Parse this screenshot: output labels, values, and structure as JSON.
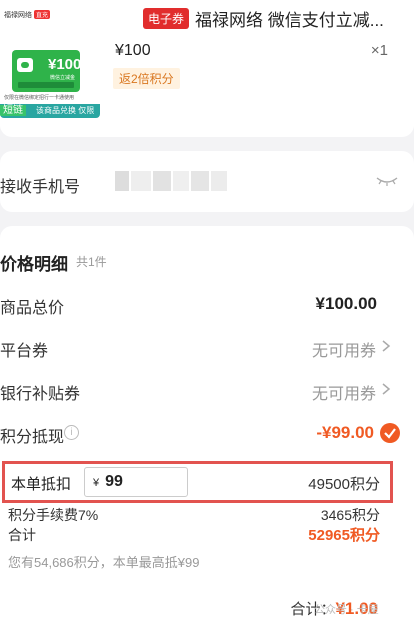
{
  "product": {
    "tag": "电子券",
    "title": "福禄网络 微信支付立减...",
    "price": "¥100",
    "qty": "×1",
    "points_badge": "返2倍积分",
    "thumb": {
      "brand": "福禄网络",
      "brand_badge": "直充",
      "amount": "¥100",
      "sub": "微信立减金",
      "note": "仅限在微信绑定招行一卡通使用",
      "bottom_tag": "短链",
      "bottom_text": "该商品兑换 仅限"
    }
  },
  "phone": {
    "label": "接收手机号"
  },
  "details": {
    "title": "价格明细",
    "count": "共1件",
    "rows": [
      {
        "label": "商品总价",
        "value": "¥100.00"
      },
      {
        "label": "平台券",
        "value": "无可用券"
      },
      {
        "label": "银行补贴券",
        "value": "无可用券"
      },
      {
        "label": "积分抵现",
        "value": "-¥99.00"
      }
    ],
    "deduct": {
      "label": "本单抵扣",
      "currency": "¥",
      "input_value": "99",
      "points": "49500积分"
    },
    "fee": {
      "label": "积分手续费7%",
      "value": "3465积分"
    },
    "total": {
      "label": "合计",
      "value": "52965积分"
    },
    "hint": "您有54,686积分，本单最高抵¥99"
  },
  "footer": {
    "label": "合计：",
    "amount": "¥1.00"
  },
  "watermark": "公众号 · 卡屋",
  "colors": {
    "accent": "#f05a23",
    "red_tag": "#e12d2d",
    "highlight_border": "#e2534f"
  }
}
